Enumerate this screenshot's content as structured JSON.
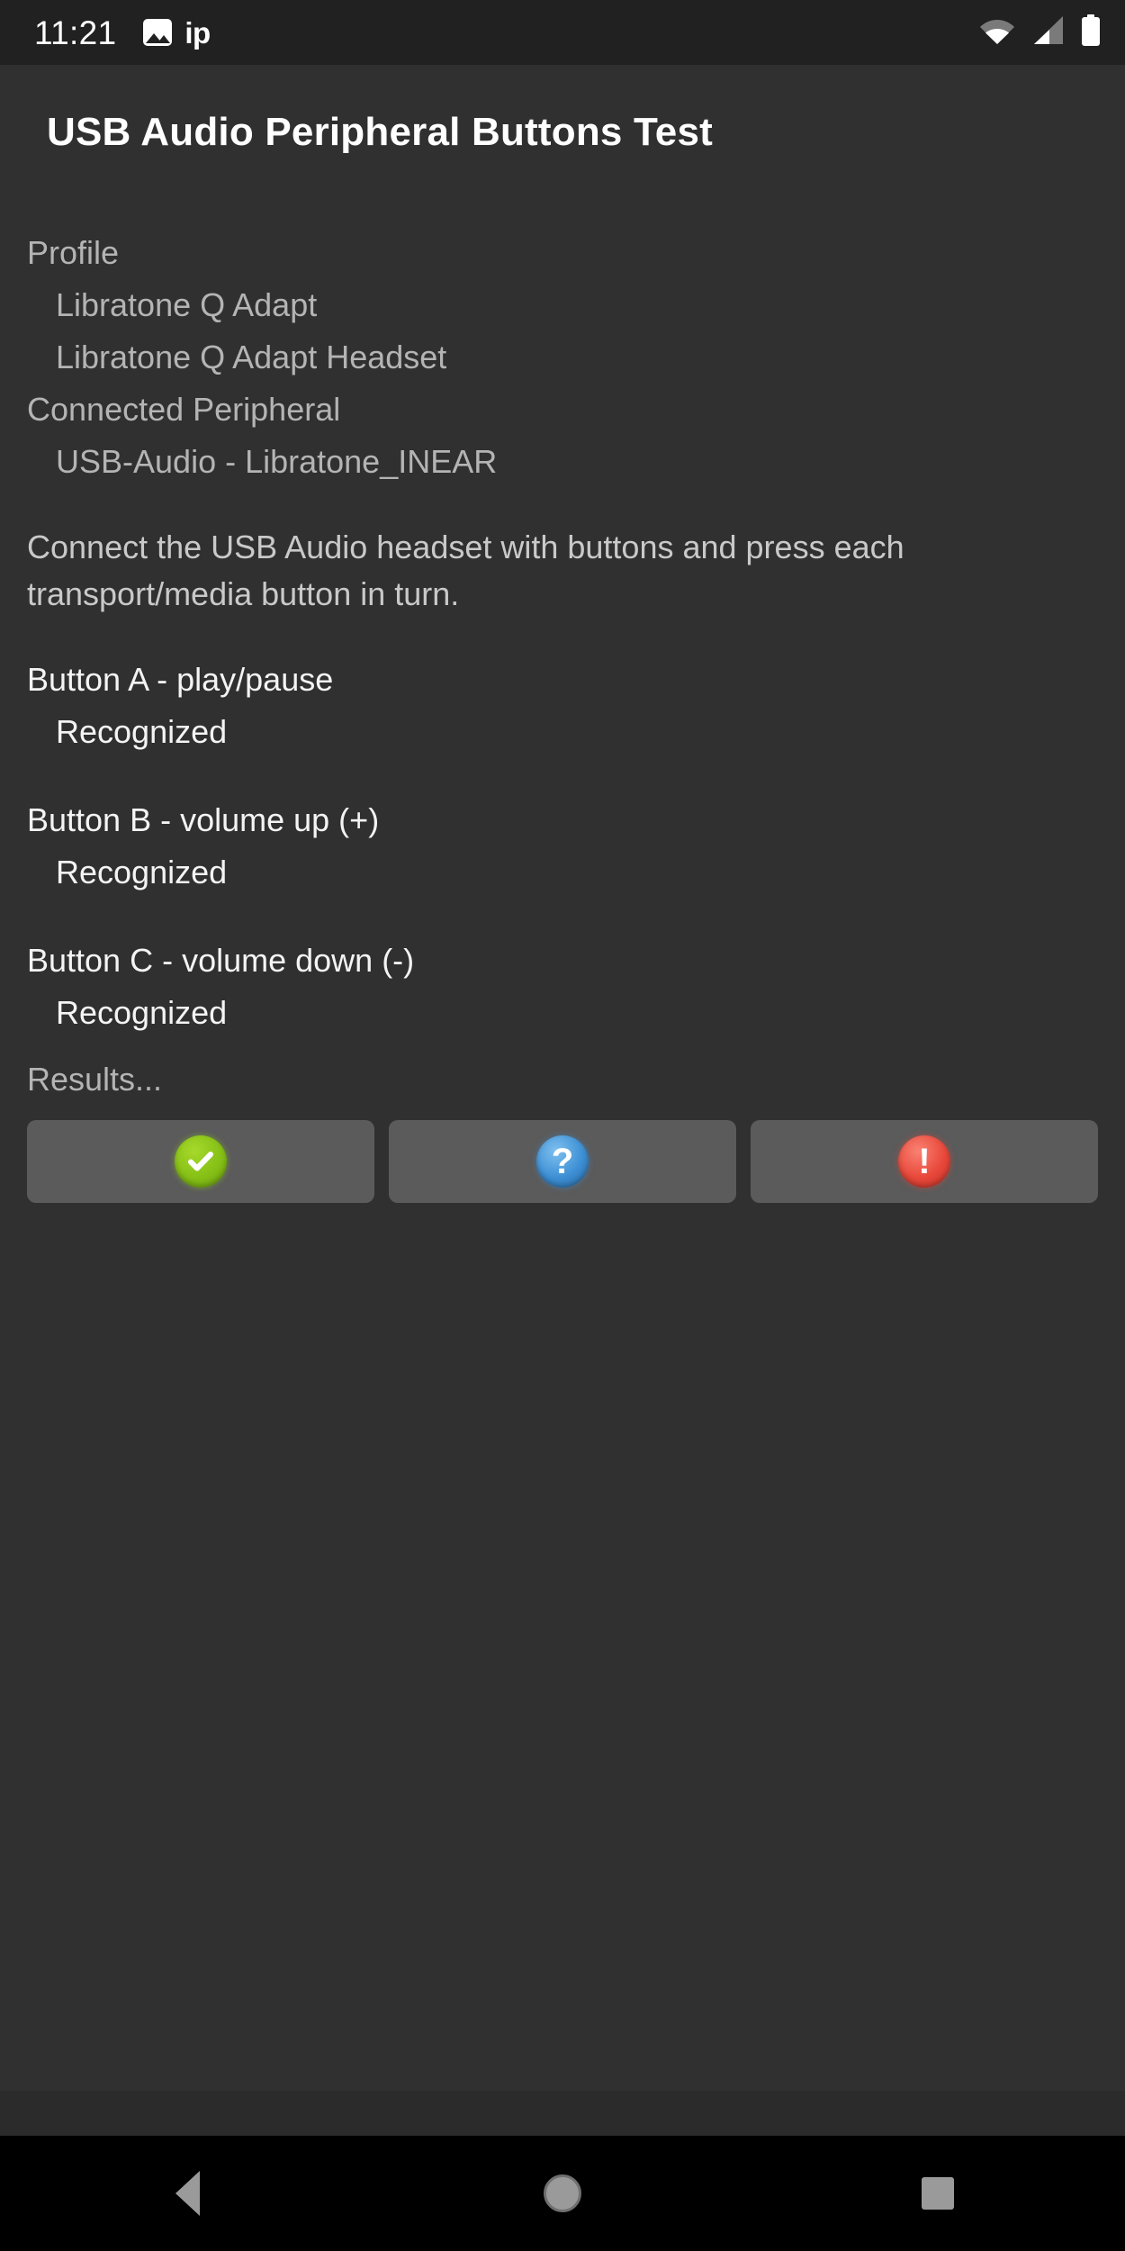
{
  "status_bar": {
    "time": "11:21",
    "icons_left": [
      "photo-icon",
      "ip-text-icon"
    ],
    "ip_label": "ip",
    "icons_right": [
      "wifi-icon",
      "cell-signal-icon",
      "battery-icon"
    ]
  },
  "app_bar": {
    "title": "USB Audio Peripheral Buttons Test"
  },
  "main": {
    "profile_label": "Profile",
    "profile_values": [
      "Libratone Q Adapt",
      "Libratone Q Adapt Headset"
    ],
    "peripheral_label": "Connected Peripheral",
    "peripheral_values": [
      "USB-Audio - Libratone_INEAR"
    ],
    "instructions": "Connect the USB Audio headset with buttons and press each transport/media button in turn.",
    "buttons": [
      {
        "label": "Button A - play/pause",
        "status": "Recognized"
      },
      {
        "label": "Button B - volume up (+)",
        "status": "Recognized"
      },
      {
        "label": "Button C - volume down (-)",
        "status": "Recognized"
      }
    ],
    "results_label": "Results..."
  },
  "result_buttons": [
    {
      "name": "pass-button",
      "glyph": "check",
      "color": "#86c016"
    },
    {
      "name": "info-button",
      "glyph": "question",
      "color": "#3d8fd4"
    },
    {
      "name": "fail-button",
      "glyph": "exclamation",
      "color": "#e8483a"
    }
  ],
  "nav_bar": {
    "items": [
      "back-button",
      "home-button",
      "recents-button"
    ]
  }
}
